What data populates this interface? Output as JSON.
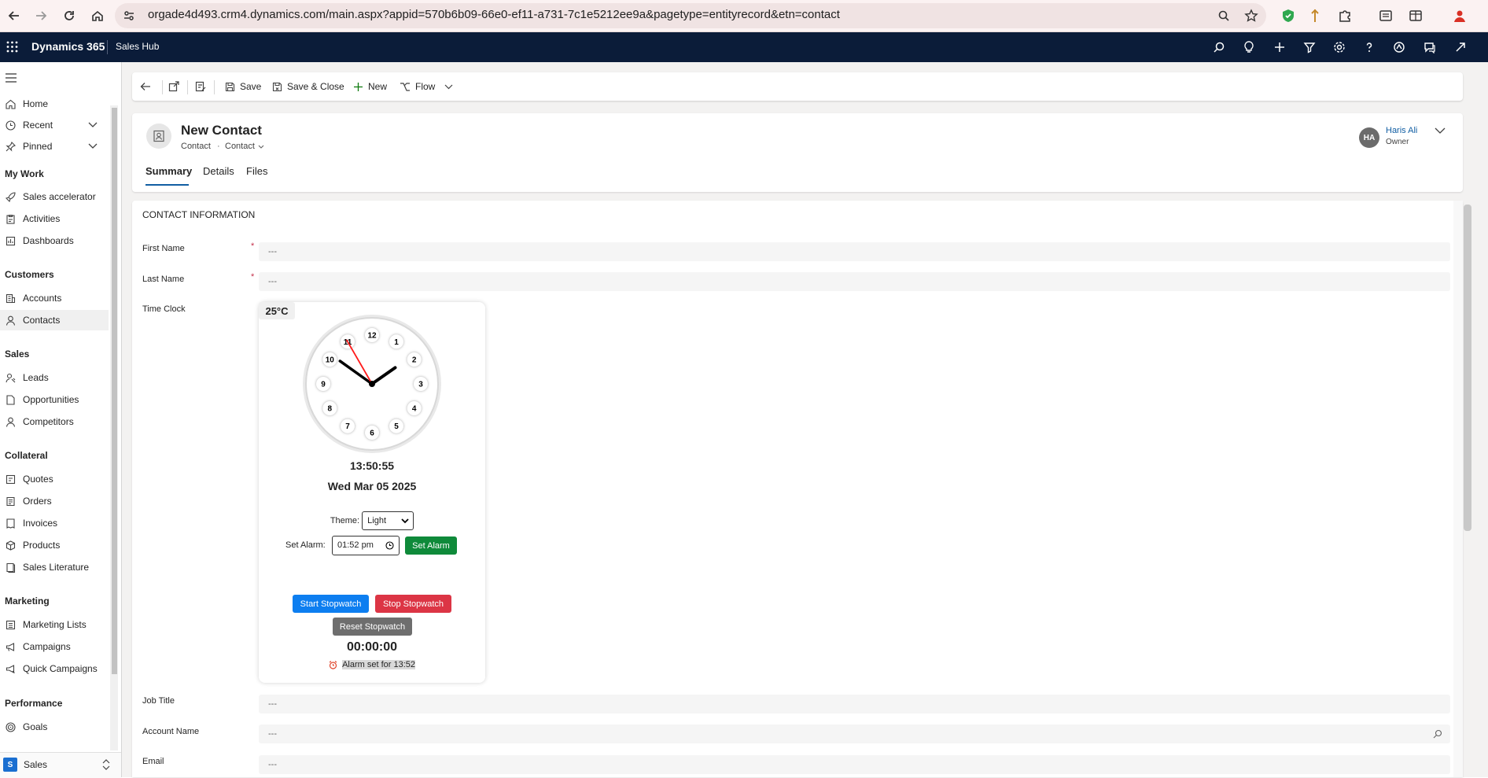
{
  "browser": {
    "url": "orgade4d493.crm4.dynamics.com/main.aspx?appid=570b6b09-66e0-ef11-a731-7c1e5212ee9a&pagetype=entityrecord&etn=contact",
    "icons": [
      "back-icon",
      "forward-icon",
      "reload-icon",
      "home-icon",
      "site-info-icon",
      "zoom-icon",
      "star-icon",
      "shield-extension-icon",
      "extension-icon",
      "puzzle-icon",
      "reading-list-icon",
      "split-view-icon",
      "profile-icon"
    ]
  },
  "app": {
    "name": "Dynamics 365",
    "hub": "Sales Hub"
  },
  "sidebar": {
    "items_top": [
      {
        "label": "Home",
        "icon": "home-icon"
      },
      {
        "label": "Recent",
        "icon": "clock-icon"
      },
      {
        "label": "Pinned",
        "icon": "pin-icon"
      }
    ],
    "sections": [
      {
        "title": "My Work",
        "items": [
          {
            "label": "Sales accelerator",
            "icon": "rocket-icon"
          },
          {
            "label": "Activities",
            "icon": "clipboard-icon"
          },
          {
            "label": "Dashboards",
            "icon": "dashboard-icon"
          }
        ]
      },
      {
        "title": "Customers",
        "items": [
          {
            "label": "Accounts",
            "icon": "building-icon"
          },
          {
            "label": "Contacts",
            "icon": "person-icon"
          }
        ]
      },
      {
        "title": "Sales",
        "items": [
          {
            "label": "Leads",
            "icon": "phone-person-icon"
          },
          {
            "label": "Opportunities",
            "icon": "document-icon"
          },
          {
            "label": "Competitors",
            "icon": "person-icon"
          }
        ]
      },
      {
        "title": "Collateral",
        "items": [
          {
            "label": "Quotes",
            "icon": "quote-icon"
          },
          {
            "label": "Orders",
            "icon": "order-icon"
          },
          {
            "label": "Invoices",
            "icon": "invoice-icon"
          },
          {
            "label": "Products",
            "icon": "box-icon"
          },
          {
            "label": "Sales Literature",
            "icon": "book-icon"
          }
        ]
      },
      {
        "title": "Marketing",
        "items": [
          {
            "label": "Marketing Lists",
            "icon": "list-icon"
          },
          {
            "label": "Campaigns",
            "icon": "megaphone-icon"
          },
          {
            "label": "Quick Campaigns",
            "icon": "quick-campaign-icon"
          }
        ]
      },
      {
        "title": "Performance",
        "items": [
          {
            "label": "Goals",
            "icon": "target-icon"
          }
        ]
      }
    ],
    "area": {
      "badge": "S",
      "label": "Sales"
    }
  },
  "commandbar": {
    "save": "Save",
    "save_close": "Save & Close",
    "new": "New",
    "flow": "Flow"
  },
  "record": {
    "title": "New Contact",
    "entity": "Contact",
    "form": "Contact",
    "owner_initials": "HA",
    "owner_name": "Haris Ali",
    "owner_role": "Owner",
    "tabs": [
      "Summary",
      "Details",
      "Files"
    ]
  },
  "form": {
    "section_title": "CONTACT INFORMATION",
    "first_name_label": "First Name",
    "last_name_label": "Last Name",
    "time_clock_label": "Time Clock",
    "job_title_label": "Job Title",
    "account_name_label": "Account Name",
    "email_label": "Email",
    "empty_value": "---",
    "required_mark": "*"
  },
  "clock": {
    "time": "13:50:55",
    "date": "Wed Mar 05 2025",
    "theme_label": "Theme:",
    "theme_value": "Light",
    "alarm_label": "Set Alarm:",
    "alarm_value": "01:52 pm",
    "set_alarm_button": "Set Alarm",
    "temperature": "25°C",
    "start_button": "Start Stopwatch",
    "stop_button": "Stop Stopwatch",
    "reset_button": "Reset Stopwatch",
    "stopwatch": "00:00:00",
    "alarm_message": "Alarm set for 13:52",
    "numerals": [
      "12",
      "1",
      "2",
      "3",
      "4",
      "5",
      "6",
      "7",
      "8",
      "9",
      "10",
      "11"
    ],
    "colors": {
      "set_alarm": "#0f8a3a",
      "start": "#0d7ef0",
      "stop": "#dc3545",
      "reset": "#6e6e6e",
      "second_hand": "#ff1a1a"
    }
  }
}
